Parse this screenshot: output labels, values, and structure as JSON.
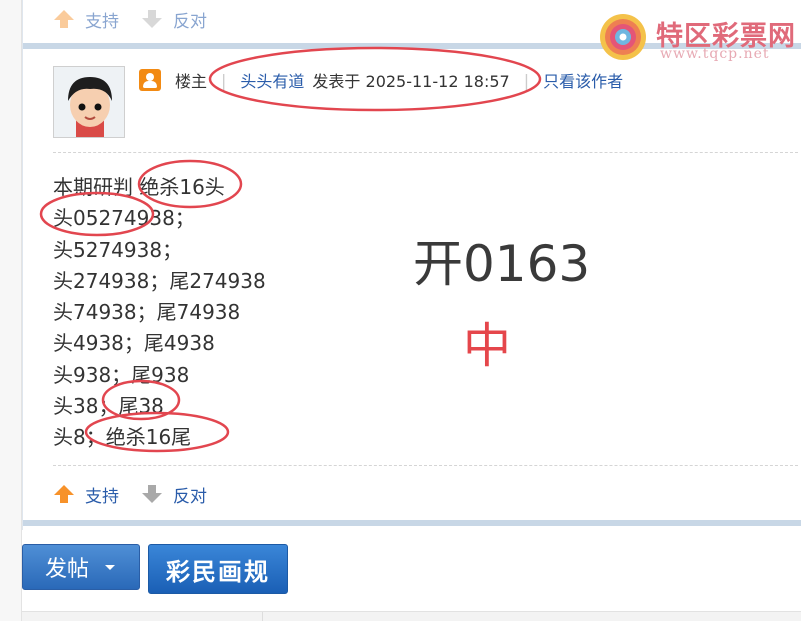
{
  "top_votes": {
    "support": "支持",
    "oppose": "反对"
  },
  "logo": {
    "title": "特区彩票网",
    "url": "www.tqcp.net"
  },
  "post": {
    "host_label": "楼主",
    "author": "头头有道",
    "posted_at": "发表于 2025-11-12 18:57",
    "only_author": "只看该作者",
    "lines": [
      "本期研判 绝杀16头",
      "头05274938；",
      "头5274938；",
      "头274938；尾274938",
      "头74938；尾74938",
      "头4938；尾4938",
      "头938；尾938",
      "头38；尾38",
      "头8；绝杀16尾"
    ],
    "result_open": "开0163",
    "result_hit": "中"
  },
  "bottom_votes": {
    "support": "支持",
    "oppose": "反对"
  },
  "actions": {
    "post_button": "发帖",
    "rules_button": "彩民画规"
  },
  "colors": {
    "link": "#2a5caa",
    "accent_red": "#e5464b",
    "separator": "#c8d7e6",
    "button_blue": "#2a69b8"
  },
  "icons": [
    "arrow-up-icon",
    "arrow-down-icon",
    "host-icon",
    "logo-swirl-icon",
    "caret-down-icon"
  ]
}
